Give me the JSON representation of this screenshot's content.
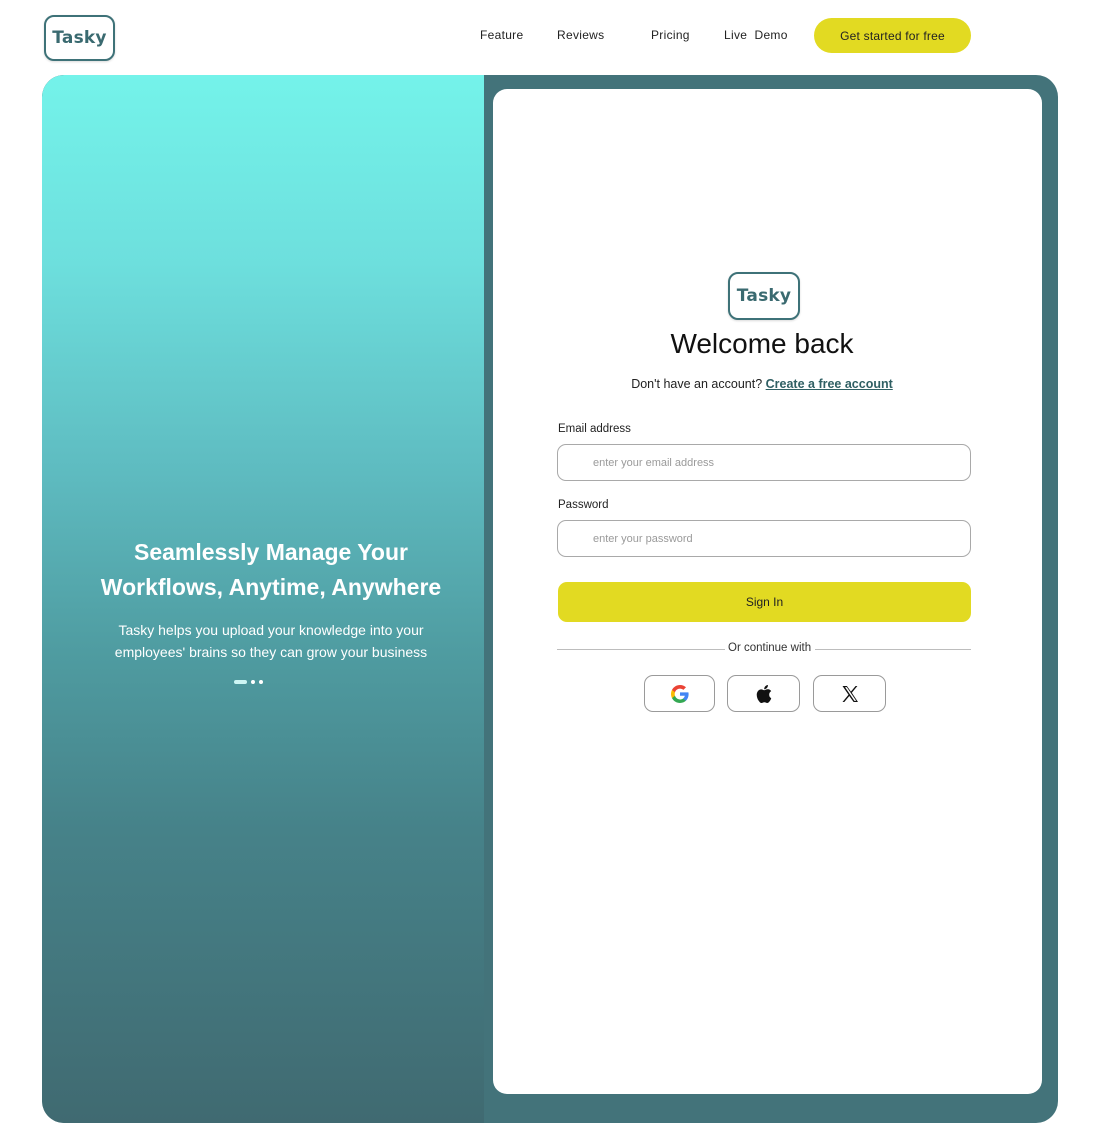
{
  "header": {
    "logo": "Tasky",
    "nav": [
      {
        "label": "Feature"
      },
      {
        "label": "Reviews"
      },
      {
        "label": "Pricing"
      },
      {
        "label": "Live  Demo"
      }
    ],
    "cta_label": "Get started for free"
  },
  "hero": {
    "title_line1": "Seamlessly Manage Your",
    "title_line2": "Workflows, Anytime, Anywhere",
    "subtitle_line1": "Tasky helps you upload your knowledge into your",
    "subtitle_line2": "employees' brains so they can grow your business",
    "carousel": {
      "total": 3,
      "active": 1
    }
  },
  "login": {
    "logo": "Tasky",
    "title": "Welcome back",
    "signup_prompt": "Don't have an account?",
    "signup_link": "Create a free account",
    "email": {
      "label": "Email address",
      "placeholder": "enter your email address",
      "value": ""
    },
    "password": {
      "label": "Password",
      "placeholder": "enter your password",
      "value": ""
    },
    "signin_label": "Sign In",
    "divider_text": "Or continue with",
    "social": [
      {
        "icon": "google-icon"
      },
      {
        "icon": "apple-icon"
      },
      {
        "icon": "x-icon"
      }
    ]
  },
  "colors": {
    "accent_yellow": "#e2da22",
    "brand_teal": "#3e7278",
    "frame_teal": "#43737a",
    "hero_top": "#74f3ea",
    "hero_bottom": "#406a71"
  }
}
